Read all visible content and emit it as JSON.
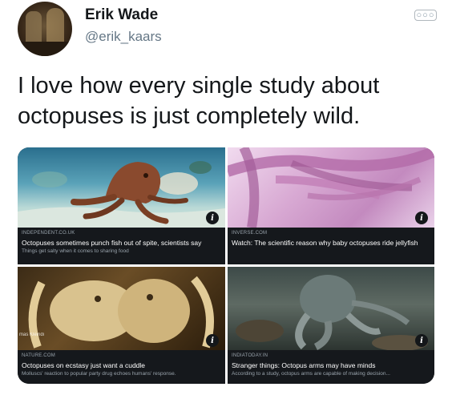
{
  "user": {
    "name": "Erik Wade",
    "handle": "@erik_kaars"
  },
  "tweet": {
    "text": "I love how every single study about octopuses is just completely wild."
  },
  "cards": [
    {
      "source": "INDEPENDENT.CO.UK",
      "headline": "Octopuses sometimes punch fish out of spite, scientists say",
      "subtitle": "Things get salty when it comes to sharing food"
    },
    {
      "source": "INVERSE.COM",
      "headline": "Watch: The scientific reason why baby octopuses ride jellyfish",
      "subtitle": ""
    },
    {
      "source": "NATURE.COM",
      "headline": "Octopuses on ecstasy just want a cuddle",
      "subtitle": "Molluscs' reaction to popular party drug echoes humans' response.",
      "watermark": "mas Kleindi"
    },
    {
      "source": "INDIATODAY.IN",
      "headline": "Stranger things: Octopus arms may have minds",
      "subtitle": "According to a study, octopus arms are capable of making decision..."
    }
  ],
  "icons": {
    "more": "more-options-icon",
    "info": "info-icon"
  }
}
